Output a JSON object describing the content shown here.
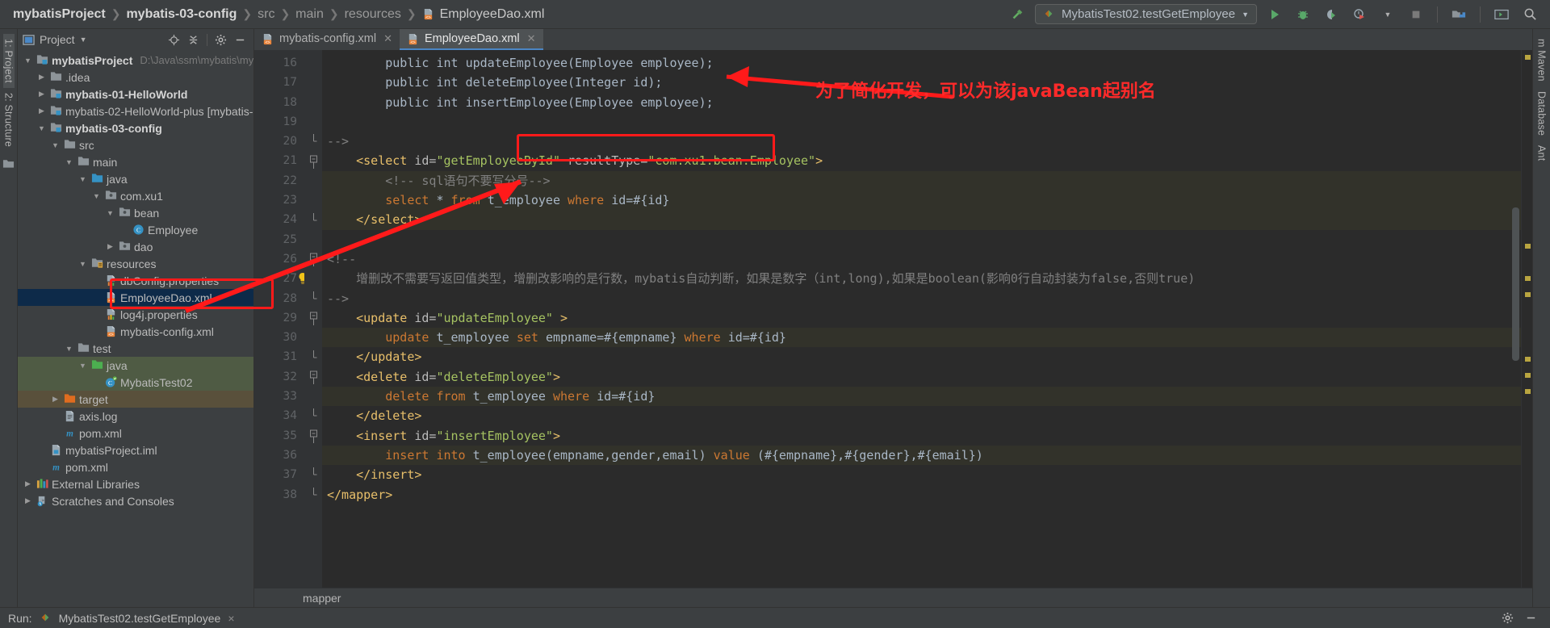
{
  "titlebar": {
    "breadcrumbs": [
      {
        "label": "mybatisProject",
        "bold": true
      },
      {
        "label": "mybatis-03-config",
        "bold": true
      },
      {
        "label": "src",
        "bold": false
      },
      {
        "label": "main",
        "bold": false
      },
      {
        "label": "resources",
        "bold": false
      }
    ],
    "current_file": "EmployeeDao.xml",
    "run_configuration": "MybatisTest02.testGetEmployee",
    "icons": [
      "hammer-build-icon",
      "run-icon",
      "debug-icon",
      "run-with-coverage-icon",
      "profiler-icon",
      "stop-icon",
      "project-structure-icon",
      "terminal-icon",
      "search-everywhere-icon"
    ]
  },
  "left_strip": {
    "items": [
      "1: Project",
      "2: Structure"
    ]
  },
  "right_strip": {
    "items": [
      "m Maven",
      "Database",
      "Ant"
    ]
  },
  "project_panel": {
    "title": "Project",
    "toolbar_icons": [
      "locate-icon",
      "collapse-all-icon",
      "settings-gear-icon",
      "hide-icon"
    ],
    "tree": [
      {
        "indent": 0,
        "arrow": "down",
        "icon": "module-icon",
        "label": "mybatisProject",
        "bold": true,
        "path": "D:\\Java\\ssm\\mybatis\\myb",
        "state": "none"
      },
      {
        "indent": 1,
        "arrow": "right",
        "icon": "folder-icon",
        "label": ".idea",
        "bold": false,
        "path": "",
        "state": "none"
      },
      {
        "indent": 1,
        "arrow": "right",
        "icon": "module-icon",
        "label": "mybatis-01-HelloWorld",
        "bold": true,
        "path": "",
        "state": "none"
      },
      {
        "indent": 1,
        "arrow": "right",
        "icon": "module-icon",
        "label": "mybatis-02-HelloWorld-plus [mybatis-",
        "bold": false,
        "path": "",
        "state": "none"
      },
      {
        "indent": 1,
        "arrow": "down",
        "icon": "module-icon",
        "label": "mybatis-03-config",
        "bold": true,
        "path": "",
        "state": "none"
      },
      {
        "indent": 2,
        "arrow": "down",
        "icon": "folder-icon",
        "label": "src",
        "bold": false,
        "path": "",
        "state": "none"
      },
      {
        "indent": 3,
        "arrow": "down",
        "icon": "folder-icon",
        "label": "main",
        "bold": false,
        "path": "",
        "state": "none"
      },
      {
        "indent": 4,
        "arrow": "down",
        "icon": "source-root-icon",
        "label": "java",
        "bold": false,
        "path": "",
        "state": "none"
      },
      {
        "indent": 5,
        "arrow": "down",
        "icon": "package-icon",
        "label": "com.xu1",
        "bold": false,
        "path": "",
        "state": "none"
      },
      {
        "indent": 6,
        "arrow": "down",
        "icon": "package-icon",
        "label": "bean",
        "bold": false,
        "path": "",
        "state": "none"
      },
      {
        "indent": 7,
        "arrow": "none",
        "icon": "class-icon",
        "label": "Employee",
        "bold": false,
        "path": "",
        "state": "none"
      },
      {
        "indent": 6,
        "arrow": "right",
        "icon": "package-icon",
        "label": "dao",
        "bold": false,
        "path": "",
        "state": "none"
      },
      {
        "indent": 4,
        "arrow": "down",
        "icon": "resource-root-icon",
        "label": "resources",
        "bold": false,
        "path": "",
        "state": "none"
      },
      {
        "indent": 5,
        "arrow": "none",
        "icon": "properties-icon",
        "label": "dbConfig.properties",
        "bold": false,
        "path": "",
        "state": "none"
      },
      {
        "indent": 5,
        "arrow": "none",
        "icon": "xml-icon",
        "label": "EmployeeDao.xml",
        "bold": false,
        "path": "",
        "state": "selected"
      },
      {
        "indent": 5,
        "arrow": "none",
        "icon": "properties-icon",
        "label": "log4j.properties",
        "bold": false,
        "path": "",
        "state": "none"
      },
      {
        "indent": 5,
        "arrow": "none",
        "icon": "xml-icon",
        "label": "mybatis-config.xml",
        "bold": false,
        "path": "",
        "state": "none"
      },
      {
        "indent": 3,
        "arrow": "down",
        "icon": "folder-icon",
        "label": "test",
        "bold": false,
        "path": "",
        "state": "none"
      },
      {
        "indent": 4,
        "arrow": "down",
        "icon": "test-root-icon",
        "label": "java",
        "bold": false,
        "path": "",
        "state": "green"
      },
      {
        "indent": 5,
        "arrow": "none",
        "icon": "test-class-icon",
        "label": "MybatisTest02",
        "bold": false,
        "path": "",
        "state": "green"
      },
      {
        "indent": 2,
        "arrow": "right",
        "icon": "target-folder-icon",
        "label": "target",
        "bold": false,
        "path": "",
        "state": "brown"
      },
      {
        "indent": 2,
        "arrow": "none",
        "icon": "file-icon",
        "label": "axis.log",
        "bold": false,
        "path": "",
        "state": "none"
      },
      {
        "indent": 2,
        "arrow": "none",
        "icon": "maven-icon",
        "label": "pom.xml",
        "bold": false,
        "path": "",
        "state": "none"
      },
      {
        "indent": 1,
        "arrow": "none",
        "icon": "iml-icon",
        "label": "mybatisProject.iml",
        "bold": false,
        "path": "",
        "state": "none"
      },
      {
        "indent": 1,
        "arrow": "none",
        "icon": "maven-icon",
        "label": "pom.xml",
        "bold": false,
        "path": "",
        "state": "none"
      },
      {
        "indent": 0,
        "arrow": "right",
        "icon": "libraries-icon",
        "label": "External Libraries",
        "bold": false,
        "path": "",
        "state": "none"
      },
      {
        "indent": 0,
        "arrow": "right",
        "icon": "scratches-icon",
        "label": "Scratches and Consoles",
        "bold": false,
        "path": "",
        "state": "none"
      }
    ]
  },
  "editor": {
    "tabs": [
      {
        "label": "mybatis-config.xml",
        "icon": "xml-icon",
        "active": false
      },
      {
        "label": "EmployeeDao.xml",
        "icon": "xml-icon",
        "active": true
      }
    ],
    "first_line_number": 16,
    "lines": [
      {
        "n": 16,
        "fold": "",
        "highlight": false,
        "segments": [
          {
            "t": "        ",
            "c": "plain"
          },
          {
            "t": "public int updateEmployee(Employee employee);",
            "c": "txt"
          }
        ]
      },
      {
        "n": 17,
        "fold": "",
        "highlight": false,
        "segments": [
          {
            "t": "        ",
            "c": "plain"
          },
          {
            "t": "public int deleteEmployee(Integer id);",
            "c": "txt"
          }
        ]
      },
      {
        "n": 18,
        "fold": "",
        "highlight": false,
        "segments": [
          {
            "t": "        ",
            "c": "plain"
          },
          {
            "t": "public int insertEmployee(Employee employee);",
            "c": "txt"
          }
        ]
      },
      {
        "n": 19,
        "fold": "",
        "highlight": false,
        "segments": []
      },
      {
        "n": 20,
        "fold": "end",
        "highlight": false,
        "segments": [
          {
            "t": "-->",
            "c": "cmt"
          }
        ]
      },
      {
        "n": 21,
        "fold": "collapse",
        "highlight": false,
        "segments": [
          {
            "t": "    ",
            "c": "plain"
          },
          {
            "t": "<select ",
            "c": "tagp"
          },
          {
            "t": "id=",
            "c": "attr"
          },
          {
            "t": "\"getEmployeeById\"",
            "c": "val"
          },
          {
            "t": " ",
            "c": "plain"
          },
          {
            "t": "resultType=",
            "c": "attr"
          },
          {
            "t": "\"com.xu1.bean.Employee\"",
            "c": "val"
          },
          {
            "t": ">",
            "c": "tagp"
          }
        ]
      },
      {
        "n": 22,
        "fold": "",
        "highlight": true,
        "segments": [
          {
            "t": "        ",
            "c": "plain"
          },
          {
            "t": "<!-- sql语句不要写分号-->",
            "c": "cmt"
          }
        ]
      },
      {
        "n": 23,
        "fold": "",
        "highlight": true,
        "segments": [
          {
            "t": "        ",
            "c": "plain"
          },
          {
            "t": "select ",
            "c": "kw"
          },
          {
            "t": "* ",
            "c": "txt"
          },
          {
            "t": "from ",
            "c": "kw"
          },
          {
            "t": "t_employee ",
            "c": "txt"
          },
          {
            "t": "where ",
            "c": "kw"
          },
          {
            "t": "id=#{id}",
            "c": "txt"
          }
        ]
      },
      {
        "n": 24,
        "fold": "end",
        "highlight": true,
        "segments": [
          {
            "t": "    ",
            "c": "plain"
          },
          {
            "t": "</select>",
            "c": "tagp"
          }
        ]
      },
      {
        "n": 25,
        "fold": "",
        "highlight": false,
        "segments": []
      },
      {
        "n": 26,
        "fold": "collapse",
        "highlight": false,
        "segments": [
          {
            "t": "<!--",
            "c": "cmt"
          }
        ]
      },
      {
        "n": 27,
        "fold": "",
        "highlight": false,
        "segments": [
          {
            "t": "    增删改不需要写返回值类型，增删改影响的是行数，mybatis自动判断，如果是数字（int,long),如果是boolean(影响0行自动封装为false,否则true)",
            "c": "cmt"
          }
        ]
      },
      {
        "n": 28,
        "fold": "end",
        "highlight": false,
        "segments": [
          {
            "t": "-->",
            "c": "cmt"
          }
        ]
      },
      {
        "n": 29,
        "fold": "collapse",
        "highlight": false,
        "segments": [
          {
            "t": "    ",
            "c": "plain"
          },
          {
            "t": "<update ",
            "c": "tagp"
          },
          {
            "t": "id=",
            "c": "attr"
          },
          {
            "t": "\"updateEmployee\"",
            "c": "val"
          },
          {
            "t": " >",
            "c": "tagp"
          }
        ]
      },
      {
        "n": 30,
        "fold": "",
        "highlight": true,
        "segments": [
          {
            "t": "        ",
            "c": "plain"
          },
          {
            "t": "update ",
            "c": "kw"
          },
          {
            "t": "t_employee ",
            "c": "txt"
          },
          {
            "t": "set ",
            "c": "kw"
          },
          {
            "t": "empname=#{empname} ",
            "c": "txt"
          },
          {
            "t": "where ",
            "c": "kw"
          },
          {
            "t": "id=#{id}",
            "c": "txt"
          }
        ]
      },
      {
        "n": 31,
        "fold": "end",
        "highlight": false,
        "segments": [
          {
            "t": "    ",
            "c": "plain"
          },
          {
            "t": "</update>",
            "c": "tagp"
          }
        ]
      },
      {
        "n": 32,
        "fold": "collapse",
        "highlight": false,
        "segments": [
          {
            "t": "    ",
            "c": "plain"
          },
          {
            "t": "<delete ",
            "c": "tagp"
          },
          {
            "t": "id=",
            "c": "attr"
          },
          {
            "t": "\"deleteEmployee\"",
            "c": "val"
          },
          {
            "t": ">",
            "c": "tagp"
          }
        ]
      },
      {
        "n": 33,
        "fold": "",
        "highlight": true,
        "segments": [
          {
            "t": "        ",
            "c": "plain"
          },
          {
            "t": "delete ",
            "c": "kw"
          },
          {
            "t": "from ",
            "c": "kw"
          },
          {
            "t": "t_employee ",
            "c": "txt"
          },
          {
            "t": "where ",
            "c": "kw"
          },
          {
            "t": "id=#{id}",
            "c": "txt"
          }
        ]
      },
      {
        "n": 34,
        "fold": "end",
        "highlight": false,
        "segments": [
          {
            "t": "    ",
            "c": "plain"
          },
          {
            "t": "</delete>",
            "c": "tagp"
          }
        ]
      },
      {
        "n": 35,
        "fold": "collapse",
        "highlight": false,
        "segments": [
          {
            "t": "    ",
            "c": "plain"
          },
          {
            "t": "<insert ",
            "c": "tagp"
          },
          {
            "t": "id=",
            "c": "attr"
          },
          {
            "t": "\"insertEmployee\"",
            "c": "val"
          },
          {
            "t": ">",
            "c": "tagp"
          }
        ]
      },
      {
        "n": 36,
        "fold": "",
        "highlight": true,
        "segments": [
          {
            "t": "        ",
            "c": "plain"
          },
          {
            "t": "insert ",
            "c": "kw"
          },
          {
            "t": "into ",
            "c": "kw"
          },
          {
            "t": "t_employee(empname,gender,email) ",
            "c": "txt"
          },
          {
            "t": "value ",
            "c": "kw"
          },
          {
            "t": "(#{empname},#{gender},#{email})",
            "c": "txt"
          }
        ]
      },
      {
        "n": 37,
        "fold": "end",
        "highlight": false,
        "segments": [
          {
            "t": "    ",
            "c": "plain"
          },
          {
            "t": "</insert>",
            "c": "tagp"
          }
        ]
      },
      {
        "n": 38,
        "fold": "end",
        "highlight": false,
        "segments": [
          {
            "t": "</mapper>",
            "c": "tagp"
          }
        ]
      }
    ],
    "breadcrumb": "mapper"
  },
  "annotations": {
    "note_text": "为了简化开发，可以为该javaBean起别名",
    "note_color": "#ff1a1a"
  },
  "run_panel": {
    "label": "Run:",
    "config_name": "MybatisTest02.testGetEmployee",
    "close_label": "×"
  }
}
